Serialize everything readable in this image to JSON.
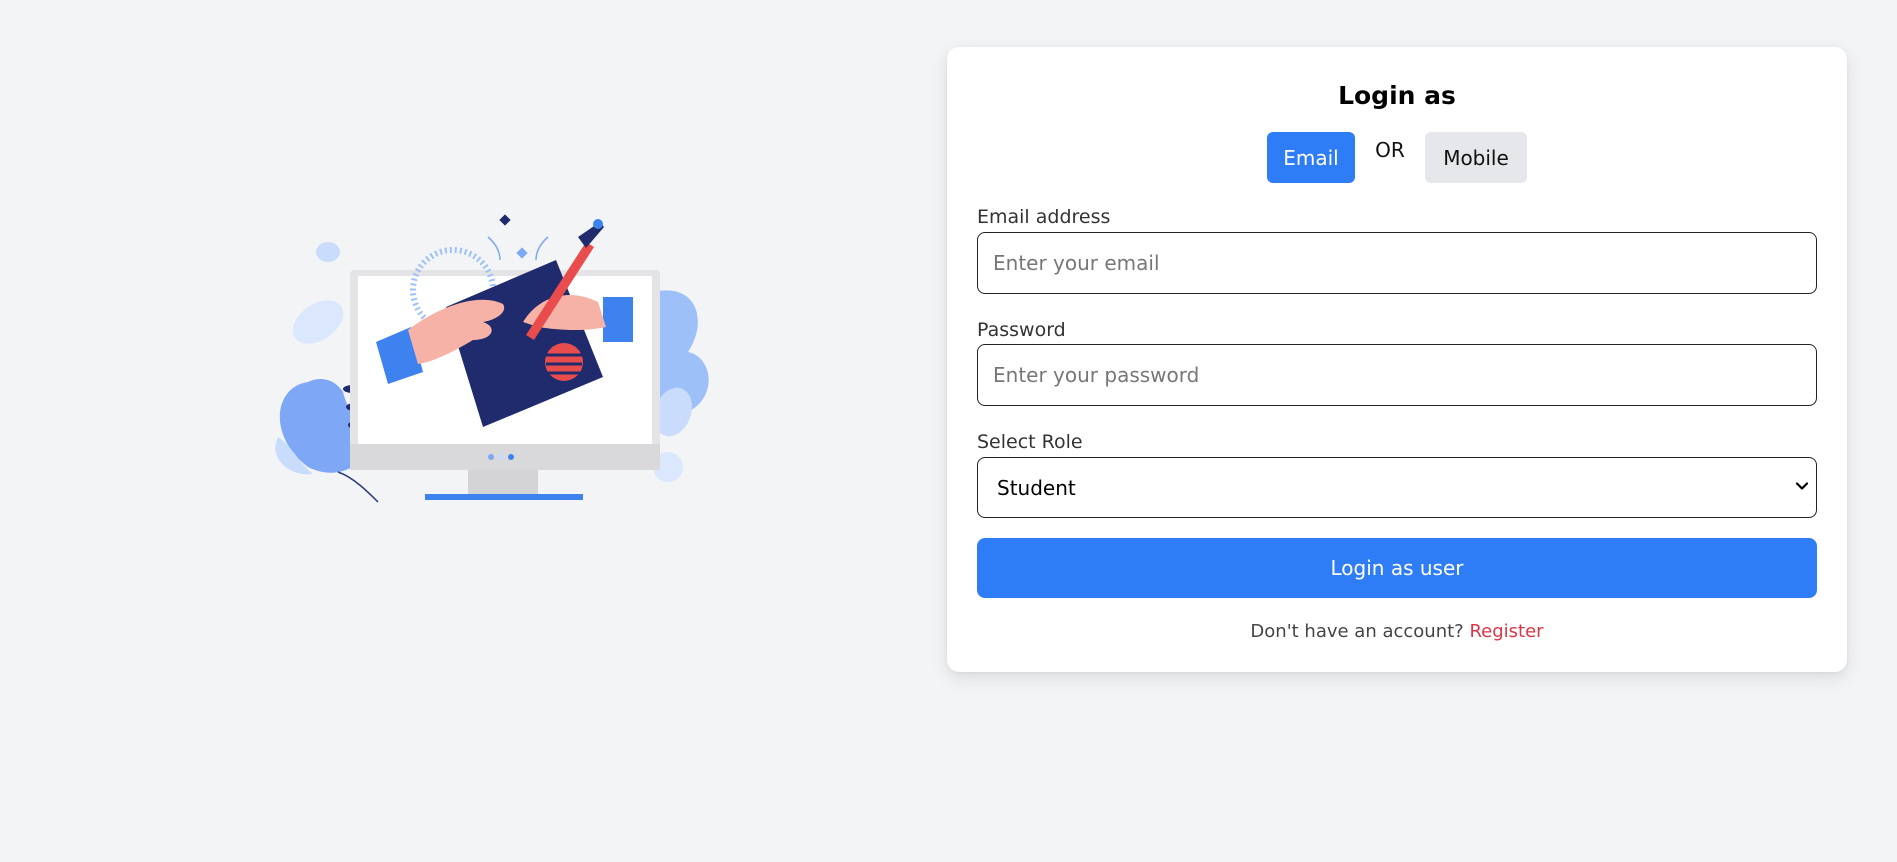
{
  "login": {
    "title": "Login as",
    "email_toggle": "Email",
    "or_text": "OR",
    "mobile_toggle": "Mobile",
    "email_label": "Email address",
    "email_placeholder": "Enter your email",
    "email_value": "",
    "password_label": "Password",
    "password_placeholder": "Enter your password",
    "password_value": "",
    "role_label": "Select Role",
    "role_selected": "Student",
    "submit_label": "Login as user",
    "no_account_text": "Don't have an account?",
    "register_link": "Register"
  },
  "colors": {
    "primary": "#2f7df6",
    "secondary_button": "#e5e7eb",
    "register_link": "#dc3545",
    "page_background": "#f3f4f6"
  },
  "icons": {
    "role_dropdown": "chevron-down-icon",
    "illustration": "computer-signing-illustration"
  }
}
